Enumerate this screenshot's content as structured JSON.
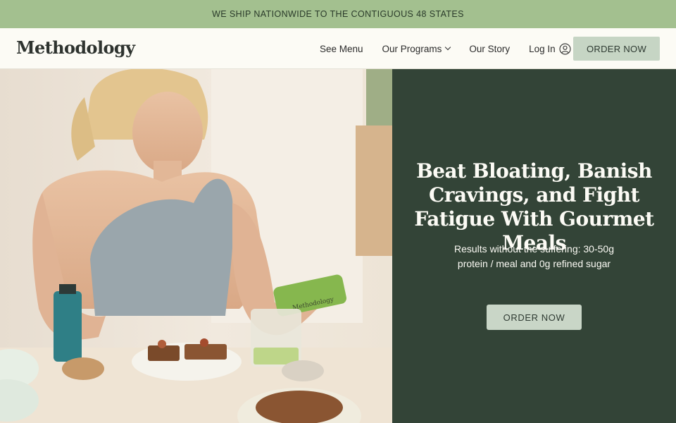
{
  "announcement": "WE SHIP NATIONWIDE TO THE CONTIGUOUS 48 STATES",
  "brand": {
    "logo_text": "Methodology"
  },
  "nav": {
    "see_menu": "See Menu",
    "our_programs": "Our Programs",
    "our_story": "Our Story",
    "log_in": "Log In",
    "order_now": "ORDER NOW"
  },
  "hero": {
    "title": "Beat Bloating, Banish Cravings, and Fight Fatigue With Gourmet Meals",
    "subtitle": "Results without the suffering: 30-50g protein / meal and 0g refined sugar",
    "cta": "ORDER NOW",
    "bottle_label": "Methodology"
  },
  "colors": {
    "announcement_bg": "#a3c08f",
    "hero_panel_bg": "#334437",
    "button_bg": "#c6d5c4",
    "page_bg": "#fcfbf5"
  },
  "icons": {
    "account": "user-circle-icon",
    "dropdown": "chevron-down-icon"
  }
}
